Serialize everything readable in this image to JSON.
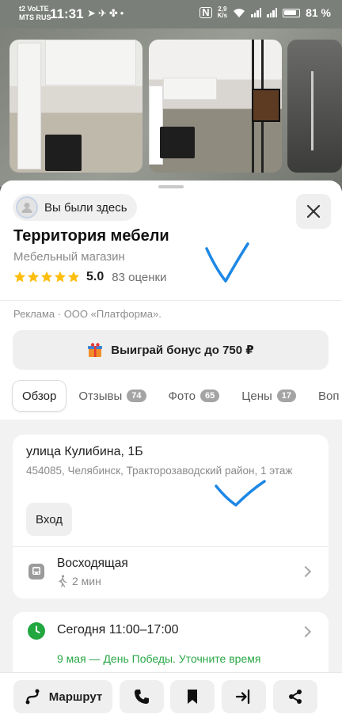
{
  "status_bar": {
    "carrier_top": "t2 VoLTE",
    "carrier_bottom": "MTS RUS",
    "time": "11:31",
    "speed_value": "2,9",
    "speed_unit": "K/s",
    "battery_percent": "81 %"
  },
  "place": {
    "visited_label": "Вы были здесь",
    "title": "Территория мебели",
    "category": "Мебельный магазин",
    "rating_value": "5.0",
    "rating_stars": 5,
    "rating_count": "83 оценки",
    "ad_text": "Реклама · ООО «Платформа».",
    "bonus_label": "Выиграй бонус до 750 ₽"
  },
  "tabs": [
    {
      "label": "Обзор",
      "badge": ""
    },
    {
      "label": "Отзывы",
      "badge": "74"
    },
    {
      "label": "Фото",
      "badge": "65"
    },
    {
      "label": "Цены",
      "badge": "17"
    },
    {
      "label": "Воп",
      "badge": ""
    }
  ],
  "address": {
    "street": "улица Кулибина, 1Б",
    "details": "454085, Челябинск, Тракторозаводский район, 1 этаж",
    "entry_label": "Вход",
    "stop_name": "Восходящая",
    "walk_time": "2 мин"
  },
  "hours": {
    "today": "Сегодня 11:00–17:00",
    "holiday_note": "9 мая — День Победы. Уточните время"
  },
  "bottom_bar": {
    "route_label": "Маршрут"
  },
  "colors": {
    "accent_green": "#22a640",
    "check_mark_blue": "#1e88e5"
  }
}
